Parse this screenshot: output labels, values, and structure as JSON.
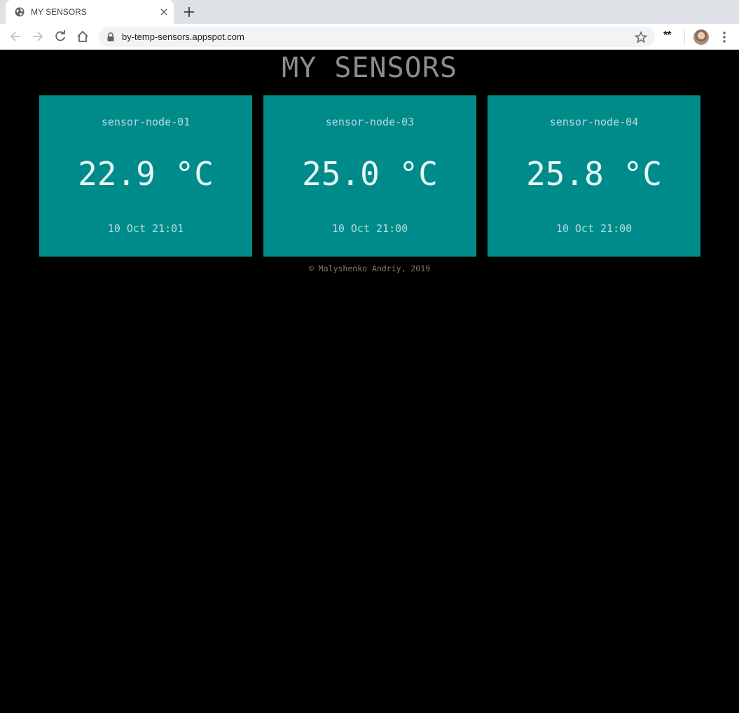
{
  "browser": {
    "tab_title": "MY SENSORS",
    "url": "by-temp-sensors.appspot.com",
    "extensions_label": "**"
  },
  "page": {
    "title": "MY SENSORS",
    "footer": "© Malyshenko Andriy, 2019",
    "colors": {
      "background": "#000000",
      "card": "#008b8b",
      "title": "#8c8c8c"
    }
  },
  "sensors": [
    {
      "name": "sensor-node-01",
      "temperature": "22.9 °C",
      "time": "10 Oct 21:01"
    },
    {
      "name": "sensor-node-03",
      "temperature": "25.0 °C",
      "time": "10 Oct 21:00"
    },
    {
      "name": "sensor-node-04",
      "temperature": "25.8 °C",
      "time": "10 Oct 21:00"
    }
  ]
}
